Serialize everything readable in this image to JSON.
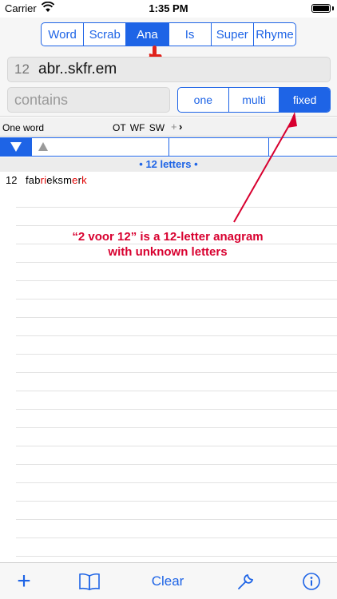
{
  "status_bar": {
    "carrier": "Carrier",
    "time": "1:35 PM"
  },
  "mode_tabs": [
    "Word",
    "Scrab",
    "Ana",
    "Is",
    "Super",
    "Rhyme"
  ],
  "mode_selected": "Ana",
  "query": {
    "length": "12",
    "pattern": "abr..skfr.em"
  },
  "contains_field": {
    "placeholder": "contains"
  },
  "match_modes": [
    "one",
    "multi",
    "fixed"
  ],
  "match_selected": "fixed",
  "options": {
    "one_word": "One word",
    "flags": "OT  WF  SW",
    "plus": "+",
    "chevron": "›"
  },
  "results": {
    "section_header": "• 12 letters •",
    "rows": [
      {
        "length": "12",
        "word_parts": [
          "fab",
          "ri",
          "eksm",
          "e",
          "r",
          "k"
        ]
      }
    ]
  },
  "annotation": {
    "line1": "“2 voor 12” is a 12-letter anagram",
    "line2": "with unknown letters",
    "color": "#d8002f"
  },
  "toolbar": {
    "clear_label": "Clear"
  },
  "icons": {
    "wifi": "wifi-icon",
    "battery": "battery-icon",
    "finger": "pointing-hand-icon",
    "add": "plus-icon",
    "book": "book-icon",
    "wrench": "wrench-icon",
    "info": "info-icon"
  },
  "colors": {
    "accent": "#1e64e6",
    "highlight": "#e00000"
  }
}
